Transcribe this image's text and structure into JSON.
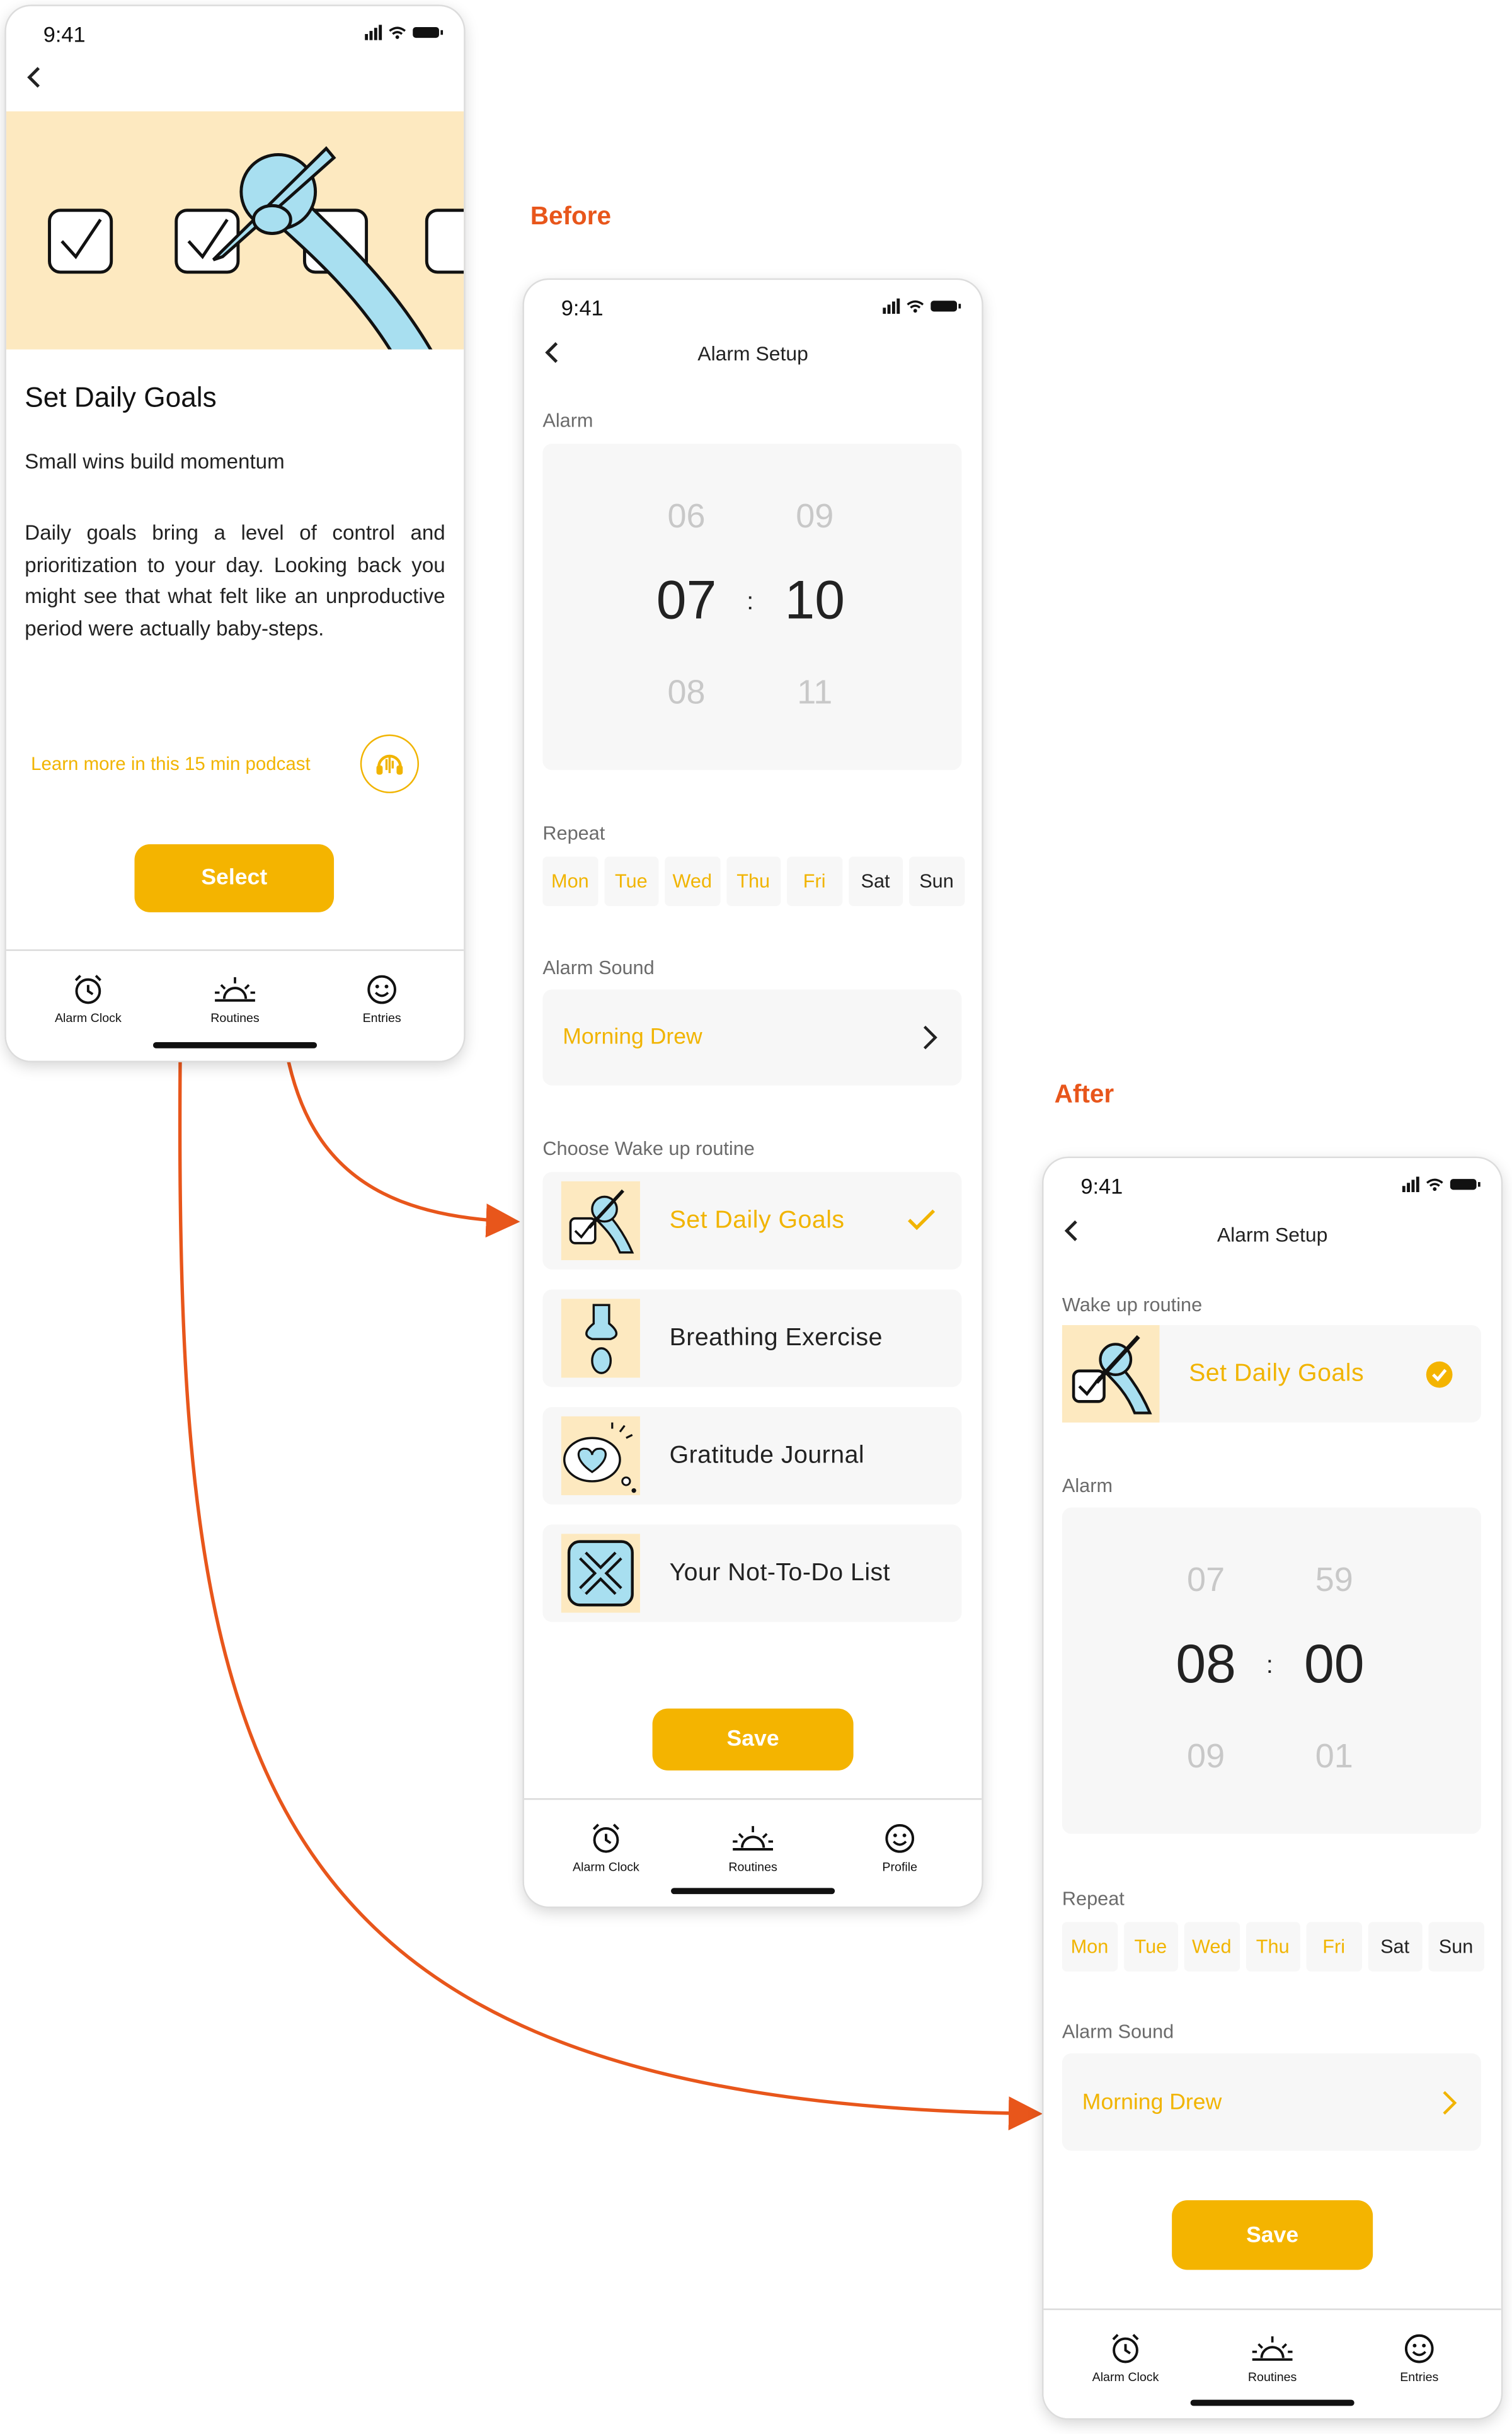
{
  "captions": {
    "before": "Before",
    "after": "After"
  },
  "status": {
    "time": "9:41"
  },
  "goal_screen": {
    "title": "Set Daily Goals",
    "subtitle": "Small wins build momentum",
    "body": "Daily goals bring a level of control and prioritization to your day. Looking back you might see that what felt like an unproductive period were actually baby-steps.",
    "podcast_link": "Learn more in this 15 min podcast",
    "select_label": "Select",
    "tabs": [
      "Alarm Clock",
      "Routines",
      "Entries"
    ]
  },
  "before_screen": {
    "title": "Alarm Setup",
    "alarm_label": "Alarm",
    "picker": {
      "hour_prev": "06",
      "hour": "07",
      "hour_next": "08",
      "min_prev": "09",
      "min": "10",
      "min_next": "11",
      "sep": ":"
    },
    "repeat_label": "Repeat",
    "days": [
      {
        "label": "Mon",
        "on": true
      },
      {
        "label": "Tue",
        "on": true
      },
      {
        "label": "Wed",
        "on": true
      },
      {
        "label": "Thu",
        "on": true
      },
      {
        "label": "Fri",
        "on": true
      },
      {
        "label": "Sat",
        "on": false
      },
      {
        "label": "Sun",
        "on": false
      }
    ],
    "sound_label": "Alarm Sound",
    "sound_value": "Morning Drew",
    "routine_label": "Choose Wake up routine",
    "routines": [
      {
        "label": "Set Daily Goals",
        "selected": true,
        "icon": "daily-goals-icon"
      },
      {
        "label": "Breathing Exercise",
        "selected": false,
        "icon": "breathing-icon"
      },
      {
        "label": "Gratitude Journal",
        "selected": false,
        "icon": "gratitude-icon"
      },
      {
        "label": "Your Not-To-Do List",
        "selected": false,
        "icon": "not-to-do-icon"
      }
    ],
    "save_label": "Save",
    "tabs": [
      "Alarm Clock",
      "Routines",
      "Profile"
    ]
  },
  "after_screen": {
    "title": "Alarm Setup",
    "routine_label": "Wake up routine",
    "routine_value": "Set Daily Goals",
    "alarm_label": "Alarm",
    "picker": {
      "hour_prev": "07",
      "hour": "08",
      "hour_next": "09",
      "min_prev": "59",
      "min": "00",
      "min_next": "01",
      "sep": ":"
    },
    "repeat_label": "Repeat",
    "days": [
      {
        "label": "Mon",
        "on": true
      },
      {
        "label": "Tue",
        "on": true
      },
      {
        "label": "Wed",
        "on": true
      },
      {
        "label": "Thu",
        "on": true
      },
      {
        "label": "Fri",
        "on": true
      },
      {
        "label": "Sat",
        "on": false
      },
      {
        "label": "Sun",
        "on": false
      }
    ],
    "sound_label": "Alarm Sound",
    "sound_value": "Morning Drew",
    "save_label": "Save",
    "tabs": [
      "Alarm Clock",
      "Routines",
      "Entries"
    ]
  },
  "colors": {
    "accent": "#f4b400",
    "accent_text": "#f1b400",
    "arrow": "#e8561b",
    "illustration_bg": "#fde9c0",
    "illustration_blue": "#a8dff0"
  }
}
